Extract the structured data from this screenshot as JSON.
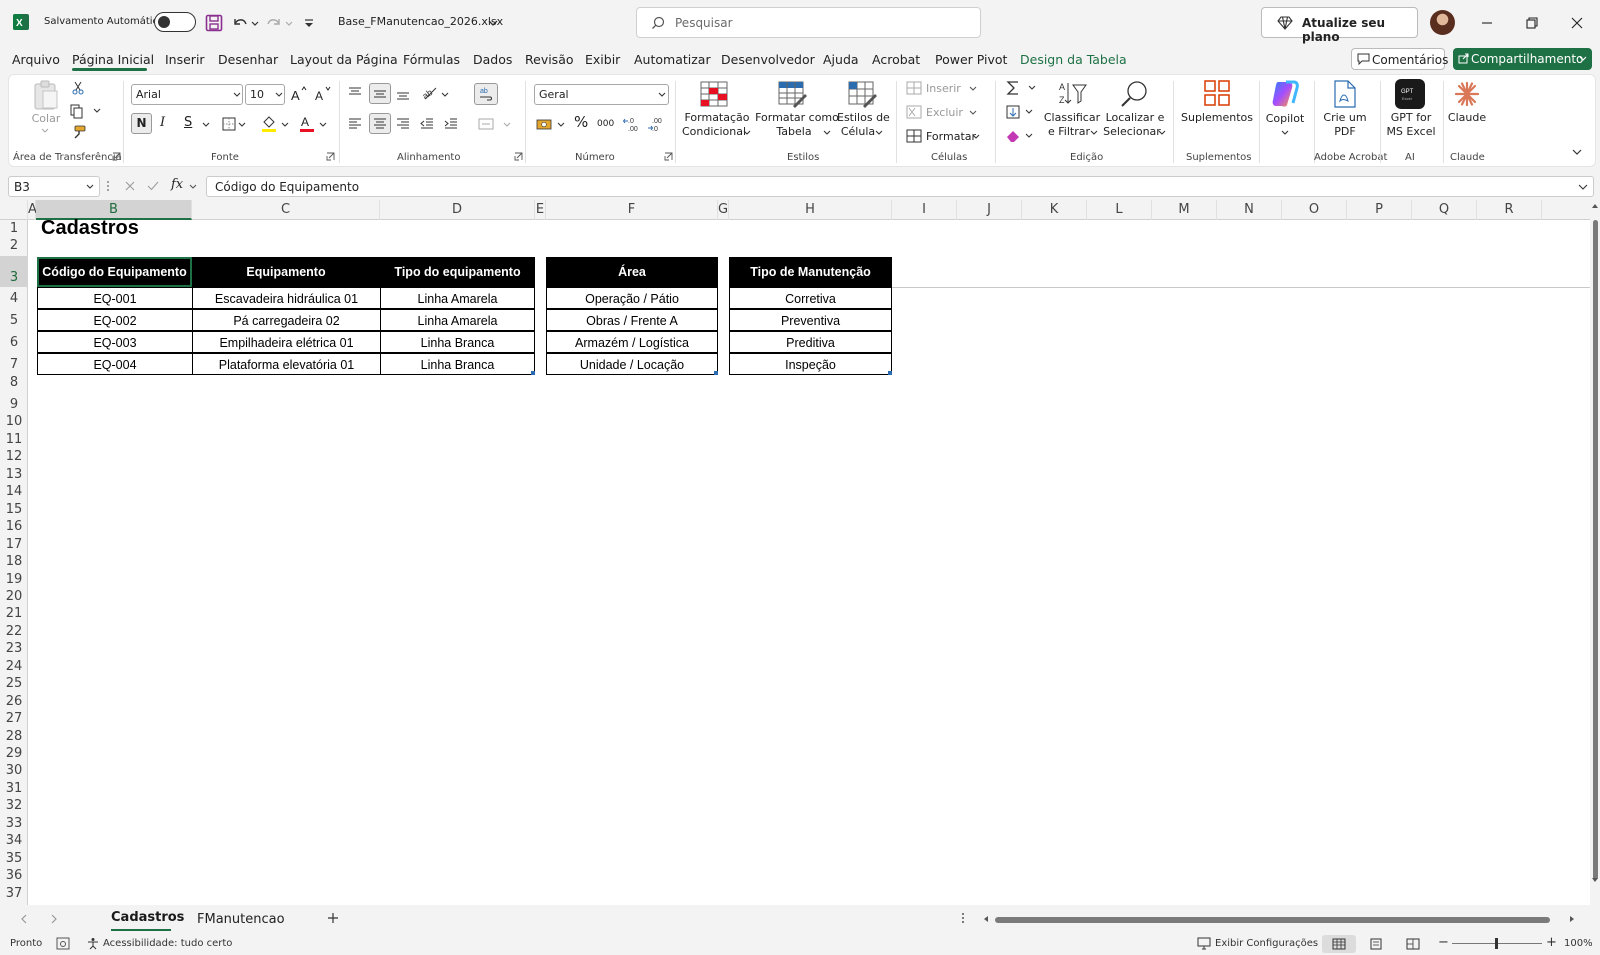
{
  "titlebar": {
    "autosave_label": "Salvamento Automático",
    "filename": "Base_FManutencao_2026.xlsx",
    "search_placeholder": "Pesquisar",
    "upgrade_label": "Atualize seu plano"
  },
  "menu": {
    "items": [
      "Arquivo",
      "Página Inicial",
      "Inserir",
      "Desenhar",
      "Layout da Página",
      "Fórmulas",
      "Dados",
      "Revisão",
      "Exibir",
      "Automatizar",
      "Desenvolvedor",
      "Ajuda",
      "Acrobat",
      "Power Pivot",
      "Design da Tabela"
    ],
    "active": "Página Inicial",
    "comments_label": "Comentários",
    "share_label": "Compartilhamento"
  },
  "ribbon": {
    "clipboard": {
      "label": "Área de Transferência",
      "paste": "Colar"
    },
    "font": {
      "label": "Fonte",
      "font_name": "Arial",
      "font_size": "10",
      "bold": "N",
      "italic": "I",
      "underline": "S"
    },
    "alignment": {
      "label": "Alinhamento"
    },
    "number": {
      "label": "Número",
      "format": "Geral",
      "percent": "%",
      "thousands": "000"
    },
    "styles": {
      "label": "Estilos",
      "conditional_1": "Formatação",
      "conditional_2": "Condicional",
      "as_table_1": "Formatar como",
      "as_table_2": "Tabela",
      "cell_styles_1": "Estilos de",
      "cell_styles_2": "Célula"
    },
    "cells": {
      "label": "Células",
      "insert": "Inserir",
      "delete": "Excluir",
      "format": "Formatar"
    },
    "editing": {
      "label": "Edição",
      "sort_1": "Classificar",
      "sort_2": "e Filtrar",
      "find_1": "Localizar e",
      "find_2": "Selecionar"
    },
    "addins": {
      "label": "Suplementos",
      "button": "Suplementos"
    },
    "copilot": {
      "button": "Copilot"
    },
    "acrobat": {
      "label": "Adobe Acrobat",
      "button_1": "Crie um",
      "button_2": "PDF"
    },
    "ai": {
      "label": "AI",
      "button_1": "GPT for",
      "button_2": "MS Excel"
    },
    "claude": {
      "label": "Claude",
      "button": "Claude"
    }
  },
  "formula_bar": {
    "name_box": "B3",
    "fx": "fx",
    "formula": "Código do Equipamento"
  },
  "grid": {
    "columns": [
      "A",
      "B",
      "C",
      "D",
      "E",
      "F",
      "G",
      "H",
      "I",
      "J",
      "K",
      "L",
      "M",
      "N",
      "O",
      "P",
      "Q",
      "R"
    ],
    "selected_column": "B",
    "rows": [
      "1",
      "2",
      "3",
      "4",
      "5",
      "6",
      "7",
      "8",
      "9",
      "10",
      "11",
      "12",
      "13",
      "14",
      "15",
      "16",
      "17",
      "18",
      "19",
      "20",
      "21",
      "22",
      "23",
      "24",
      "25",
      "26",
      "27",
      "28",
      "29",
      "30",
      "31",
      "32",
      "33",
      "34",
      "35",
      "36",
      "37"
    ],
    "selected_row": "3"
  },
  "sheet": {
    "title": "Cadastros",
    "equipment_table": {
      "headers": [
        "Código do Equipamento",
        "Equipamento",
        "Tipo do equipamento"
      ],
      "rows": [
        [
          "EQ-001",
          "Escavadeira hidráulica 01",
          "Linha Amarela"
        ],
        [
          "EQ-002",
          "Pá carregadeira 02",
          "Linha Amarela"
        ],
        [
          "EQ-003",
          "Empilhadeira elétrica 01",
          "Linha Branca"
        ],
        [
          "EQ-004",
          "Plataforma elevatória 01",
          "Linha Branca"
        ]
      ]
    },
    "area_table": {
      "header": "Área",
      "rows": [
        "Operação / Pátio",
        "Obras / Frente A",
        "Armazém / Logística",
        "Unidade / Locação"
      ]
    },
    "maintenance_table": {
      "header": "Tipo de Manutenção",
      "rows": [
        "Corretiva",
        "Preventiva",
        "Preditiva",
        "Inspeção"
      ]
    }
  },
  "tabs": {
    "items": [
      "Cadastros",
      "FManutencao"
    ],
    "active": "Cadastros"
  },
  "status": {
    "ready": "Pronto",
    "accessibility": "Acessibilidade: tudo certo",
    "display_settings": "Exibir Configurações",
    "zoom": "100%"
  },
  "colors": {
    "excel_green": "#1e7145",
    "header_black": "#000000"
  }
}
